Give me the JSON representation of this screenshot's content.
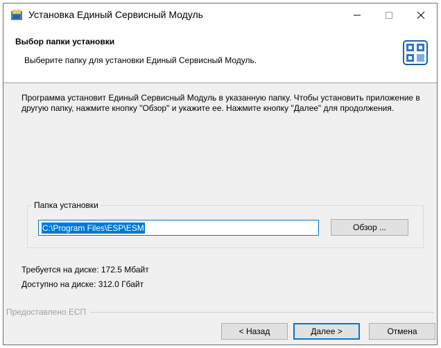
{
  "window": {
    "title": "Установка Единый Сервисный Модуль",
    "minimize_glyph": "—",
    "maximize_glyph": "☐",
    "close_glyph": "✕"
  },
  "header": {
    "title": "Выбор папки установки",
    "subtitle": "Выберите папку для установки Единый Сервисный Модуль."
  },
  "content": {
    "description": "Программа установит Единый Сервисный Модуль в указанную папку. Чтобы установить приложение в другую папку, нажмите кнопку \"Обзор\" и укажите ее. Нажмите кнопку \"Далее\" для продолжения.",
    "group_label": "Папка установки",
    "install_path": "C:\\Program Files\\ESP\\ESM",
    "browse_label": "Обзор ...",
    "space_required": "Требуется на диске: 172.5 Мбайт",
    "space_available": "Доступно на диске: 312.0 Гбайт"
  },
  "footer": {
    "branding": "Предоставлено ЕСП",
    "back_label": "< Назад",
    "next_label": "Далее >",
    "cancel_label": "Отмена"
  },
  "colors": {
    "accent": "#0078d7",
    "window_bg": "#f0f0f0",
    "header_bg": "#ffffff"
  },
  "icons": {
    "title": "app-installer-icon",
    "header": "esm-logo-icon"
  }
}
